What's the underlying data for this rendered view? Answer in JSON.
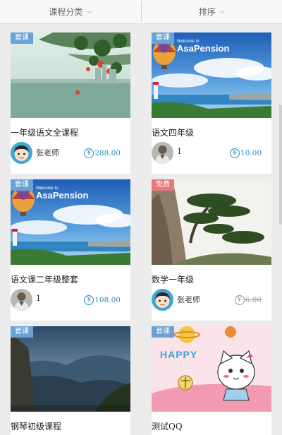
{
  "filters": [
    {
      "label": "课程分类",
      "icon": "chevron-down-icon"
    },
    {
      "label": "排序",
      "icon": "chevron-down-icon"
    }
  ],
  "courses": [
    {
      "tag": "套课",
      "tag_color": "#6aa2d6",
      "title": "一年级语文全课程",
      "teacher": "张老师",
      "avatar": "cartoon-boy-avatar",
      "price": "288.00",
      "price_struck": false,
      "image": "lake-with-tree-branches"
    },
    {
      "tag": "套课",
      "tag_color": "#6aa2d6",
      "title": "语文四年级",
      "teacher": "1",
      "avatar": "man-photo-avatar",
      "price": "10.00",
      "price_struck": false,
      "image": "asapension-coast-balloon",
      "image_text": [
        "Welcome to",
        "AsaPension"
      ]
    },
    {
      "tag": "套课",
      "tag_color": "#6aa2d6",
      "title": "语文课二年级整套",
      "teacher": "1",
      "avatar": "man-photo-avatar",
      "price": "108.00",
      "price_struck": false,
      "image": "asapension-coast-balloon",
      "image_text": [
        "Welcome to",
        "AsaPension"
      ]
    },
    {
      "tag": "免费",
      "tag_color": "#e8787c",
      "title": "数学一年级",
      "teacher": "张老师",
      "avatar": "cartoon-boy-avatar",
      "price": "6.00",
      "price_struck": true,
      "image": "pine-tree-on-cliff"
    },
    {
      "tag": "套课",
      "tag_color": "#6aa2d6",
      "title": "钢琴初级课程",
      "image": "mountain-landscape"
    },
    {
      "tag": "套课",
      "tag_color": "#6aa2d6",
      "title": "测试QQ",
      "image": "happy-cartoon-cat",
      "image_text": [
        "HAPPY"
      ]
    }
  ]
}
